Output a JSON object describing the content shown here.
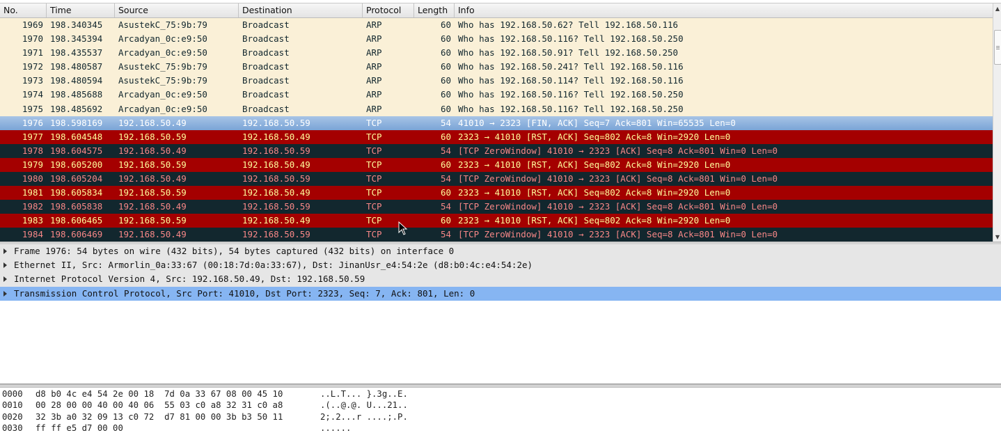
{
  "packet_list": {
    "columns": [
      "No.",
      "Time",
      "Source",
      "Destination",
      "Protocol",
      "Length",
      "Info"
    ],
    "rows": [
      {
        "no": "1969",
        "time": "198.340345",
        "src": "AsustekC_75:9b:79",
        "dst": "Broadcast",
        "proto": "ARP",
        "len": "60",
        "info": "Who has 192.168.50.62? Tell 192.168.50.116",
        "style": "arp"
      },
      {
        "no": "1970",
        "time": "198.345394",
        "src": "Arcadyan_0c:e9:50",
        "dst": "Broadcast",
        "proto": "ARP",
        "len": "60",
        "info": "Who has 192.168.50.116? Tell 192.168.50.250",
        "style": "arp"
      },
      {
        "no": "1971",
        "time": "198.435537",
        "src": "Arcadyan_0c:e9:50",
        "dst": "Broadcast",
        "proto": "ARP",
        "len": "60",
        "info": "Who has 192.168.50.91? Tell 192.168.50.250",
        "style": "arp"
      },
      {
        "no": "1972",
        "time": "198.480587",
        "src": "AsustekC_75:9b:79",
        "dst": "Broadcast",
        "proto": "ARP",
        "len": "60",
        "info": "Who has 192.168.50.241? Tell 192.168.50.116",
        "style": "arp"
      },
      {
        "no": "1973",
        "time": "198.480594",
        "src": "AsustekC_75:9b:79",
        "dst": "Broadcast",
        "proto": "ARP",
        "len": "60",
        "info": "Who has 192.168.50.114? Tell 192.168.50.116",
        "style": "arp"
      },
      {
        "no": "1974",
        "time": "198.485688",
        "src": "Arcadyan_0c:e9:50",
        "dst": "Broadcast",
        "proto": "ARP",
        "len": "60",
        "info": "Who has 192.168.50.116? Tell 192.168.50.250",
        "style": "arp"
      },
      {
        "no": "1975",
        "time": "198.485692",
        "src": "Arcadyan_0c:e9:50",
        "dst": "Broadcast",
        "proto": "ARP",
        "len": "60",
        "info": "Who has 192.168.50.116? Tell 192.168.50.250",
        "style": "arp"
      },
      {
        "no": "1976",
        "time": "198.598169",
        "src": "192.168.50.49",
        "dst": "192.168.50.59",
        "proto": "TCP",
        "len": "54",
        "info": "41010 → 2323 [FIN, ACK] Seq=7 Ack=801 Win=65535 Len=0",
        "style": "sel"
      },
      {
        "no": "1977",
        "time": "198.604548",
        "src": "192.168.50.59",
        "dst": "192.168.50.49",
        "proto": "TCP",
        "len": "60",
        "info": "2323 → 41010 [RST, ACK] Seq=802 Ack=8 Win=2920 Len=0",
        "style": "rst"
      },
      {
        "no": "1978",
        "time": "198.604575",
        "src": "192.168.50.49",
        "dst": "192.168.50.59",
        "proto": "TCP",
        "len": "54",
        "info": "[TCP ZeroWindow] 41010 → 2323 [ACK] Seq=8 Ack=801 Win=0 Len=0",
        "style": "zw"
      },
      {
        "no": "1979",
        "time": "198.605200",
        "src": "192.168.50.59",
        "dst": "192.168.50.49",
        "proto": "TCP",
        "len": "60",
        "info": "2323 → 41010 [RST, ACK] Seq=802 Ack=8 Win=2920 Len=0",
        "style": "rst"
      },
      {
        "no": "1980",
        "time": "198.605204",
        "src": "192.168.50.49",
        "dst": "192.168.50.59",
        "proto": "TCP",
        "len": "54",
        "info": "[TCP ZeroWindow] 41010 → 2323 [ACK] Seq=8 Ack=801 Win=0 Len=0",
        "style": "zw"
      },
      {
        "no": "1981",
        "time": "198.605834",
        "src": "192.168.50.59",
        "dst": "192.168.50.49",
        "proto": "TCP",
        "len": "60",
        "info": "2323 → 41010 [RST, ACK] Seq=802 Ack=8 Win=2920 Len=0",
        "style": "rst"
      },
      {
        "no": "1982",
        "time": "198.605838",
        "src": "192.168.50.49",
        "dst": "192.168.50.59",
        "proto": "TCP",
        "len": "54",
        "info": "[TCP ZeroWindow] 41010 → 2323 [ACK] Seq=8 Ack=801 Win=0 Len=0",
        "style": "zw"
      },
      {
        "no": "1983",
        "time": "198.606465",
        "src": "192.168.50.59",
        "dst": "192.168.50.49",
        "proto": "TCP",
        "len": "60",
        "info": "2323 → 41010 [RST, ACK] Seq=802 Ack=8 Win=2920 Len=0",
        "style": "rst"
      },
      {
        "no": "1984",
        "time": "198.606469",
        "src": "192.168.50.49",
        "dst": "192.168.50.59",
        "proto": "TCP",
        "len": "54",
        "info": "[TCP ZeroWindow] 41010 → 2323 [ACK] Seq=8 Ack=801 Win=0 Len=0",
        "style": "zw"
      }
    ]
  },
  "details": [
    {
      "text": "Frame 1976: 54 bytes on wire (432 bits), 54 bytes captured (432 bits) on interface 0",
      "selected": false
    },
    {
      "text": "Ethernet II, Src: Armorlin_0a:33:67 (00:18:7d:0a:33:67), Dst: JinanUsr_e4:54:2e (d8:b0:4c:e4:54:2e)",
      "selected": false
    },
    {
      "text": "Internet Protocol Version 4, Src: 192.168.50.49, Dst: 192.168.50.59",
      "selected": false
    },
    {
      "text": "Transmission Control Protocol, Src Port: 41010, Dst Port: 2323, Seq: 7, Ack: 801, Len: 0",
      "selected": true
    }
  ],
  "bytes": [
    {
      "offset": "0000",
      "hex": "d8 b0 4c e4 54 2e 00 18  7d 0a 33 67 08 00 45 10",
      "ascii": "..L.T... }.3g..E."
    },
    {
      "offset": "0010",
      "hex": "00 28 00 00 40 00 40 06  55 03 c0 a8 32 31 c0 a8",
      "ascii": ".(..@.@. U...21.."
    },
    {
      "offset": "0020",
      "hex": "32 3b a0 32 09 13 c0 72  d7 81 00 00 3b b3 50 11",
      "ascii": "2;.2...r ....;.P."
    },
    {
      "offset": "0030",
      "hex": "ff ff e5 d7 00 00",
      "ascii": "......"
    }
  ],
  "colors": {
    "arp_bg": "#faf0d7",
    "selected_bg": "#7aa4d6",
    "rst_bg": "#a40000",
    "rst_fg": "#fffc9c",
    "zerowindow_bg": "#12272e",
    "zerowindow_fg": "#f78787",
    "detail_selected_bg": "#86b5f2"
  },
  "icons": {
    "expand": "triangle-right-icon",
    "scroll_up": "arrow-up-icon",
    "scroll_down": "arrow-down-icon",
    "cursor": "mouse-pointer-icon"
  }
}
